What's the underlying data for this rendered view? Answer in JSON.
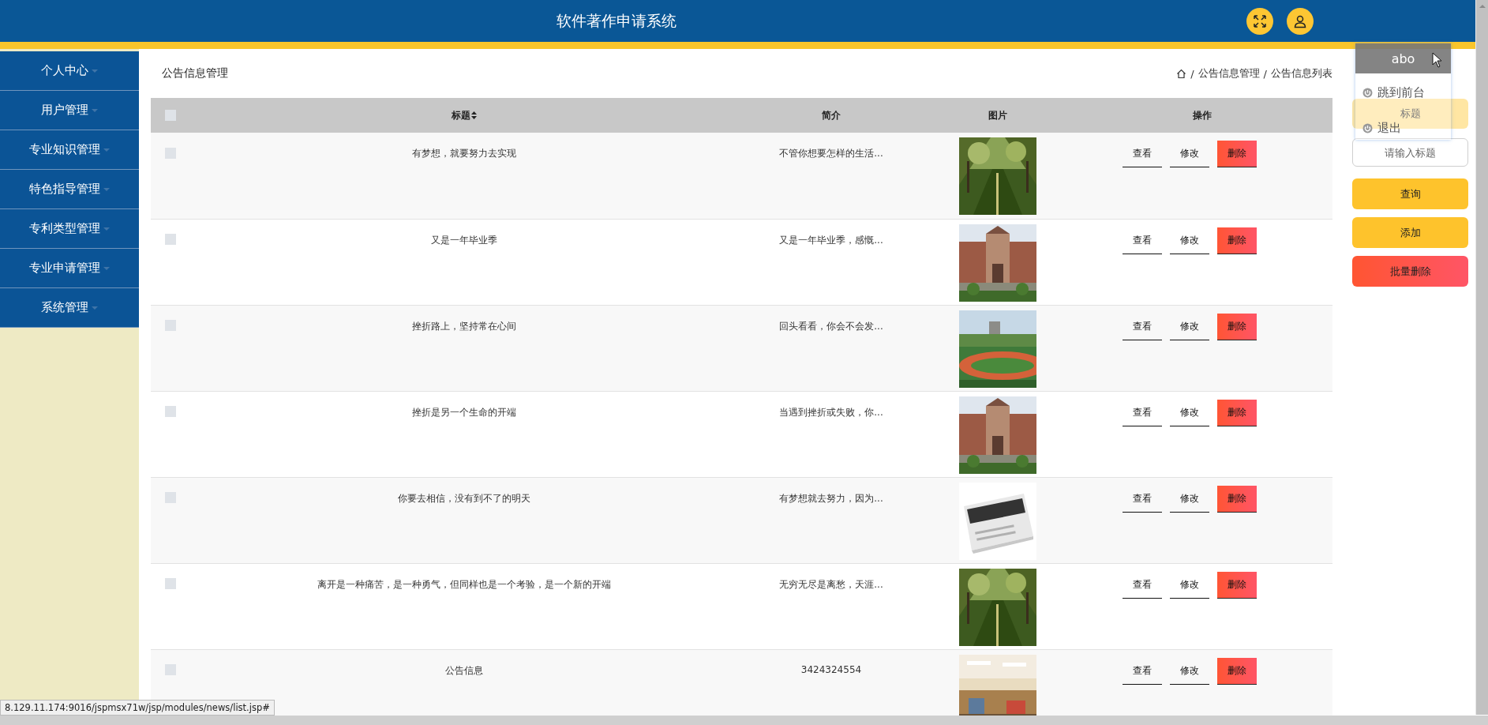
{
  "header": {
    "title": "软件著作申请系统"
  },
  "sidebar": {
    "items": [
      {
        "label": "个人中心"
      },
      {
        "label": "用户管理"
      },
      {
        "label": "专业知识管理"
      },
      {
        "label": "特色指导管理"
      },
      {
        "label": "专利类型管理"
      },
      {
        "label": "专业申请管理"
      },
      {
        "label": "系统管理"
      }
    ]
  },
  "page_title": "公告信息管理",
  "breadcrumb": [
    {
      "separator": "/",
      "label": "公告信息管理"
    },
    {
      "separator": "/",
      "label": "公告信息列表"
    }
  ],
  "table": {
    "all_checked": false,
    "columns": [
      "标题",
      "简介",
      "图片",
      "操作"
    ],
    "rows": [
      {
        "checked": false,
        "title": "有梦想，就要努力去实现",
        "summary": "不管你想要怎样的生活...",
        "image": {
          "kind": "picture"
        },
        "actions": [
          "查看",
          "修改",
          "删除"
        ]
      },
      {
        "checked": false,
        "title": "又是一年毕业季",
        "summary": "又是一年毕业季，感慨...",
        "image": {
          "kind": "picture"
        },
        "actions": [
          "查看",
          "修改",
          "删除"
        ]
      },
      {
        "checked": false,
        "title": "挫折路上，坚持常在心间",
        "summary": "回头看看，你会不会发...",
        "image": {
          "kind": "picture"
        },
        "actions": [
          "查看",
          "修改",
          "删除"
        ]
      },
      {
        "checked": false,
        "title": "挫折是另一个生命的开端",
        "summary": "当遇到挫折或失败，你...",
        "image": {
          "kind": "picture"
        },
        "actions": [
          "查看",
          "修改",
          "删除"
        ]
      },
      {
        "checked": false,
        "title": "你要去相信，没有到不了的明天",
        "summary": "有梦想就去努力，因为...",
        "image": {
          "kind": "picture"
        },
        "actions": [
          "查看",
          "修改",
          "删除"
        ]
      },
      {
        "checked": false,
        "title": "离开是一种痛苦，是一种勇气，但同样也是一个考验，是一个新的开端",
        "summary": "无穷无尽是离愁，天涯...",
        "image": {
          "kind": "picture"
        },
        "actions": [
          "查看",
          "修改",
          "删除"
        ]
      },
      {
        "checked": false,
        "title": "公告信息",
        "summary": "3424324554",
        "image": {
          "kind": "picture"
        },
        "actions": [
          "查看",
          "修改",
          "删除"
        ]
      }
    ]
  },
  "search": {
    "label": "标题",
    "placeholder": "请输入标题",
    "buttons": [
      {
        "label": "查询",
        "kind": "primary"
      },
      {
        "label": "添加",
        "kind": "primary"
      },
      {
        "label": "批量删除",
        "kind": "danger"
      }
    ]
  },
  "user_menu": {
    "username": "abo",
    "items": [
      "跳到前台",
      "退出"
    ]
  },
  "status_bar": "8.129.11.174:9016/jspmsx71w/jsp/modules/news/list.jsp#"
}
